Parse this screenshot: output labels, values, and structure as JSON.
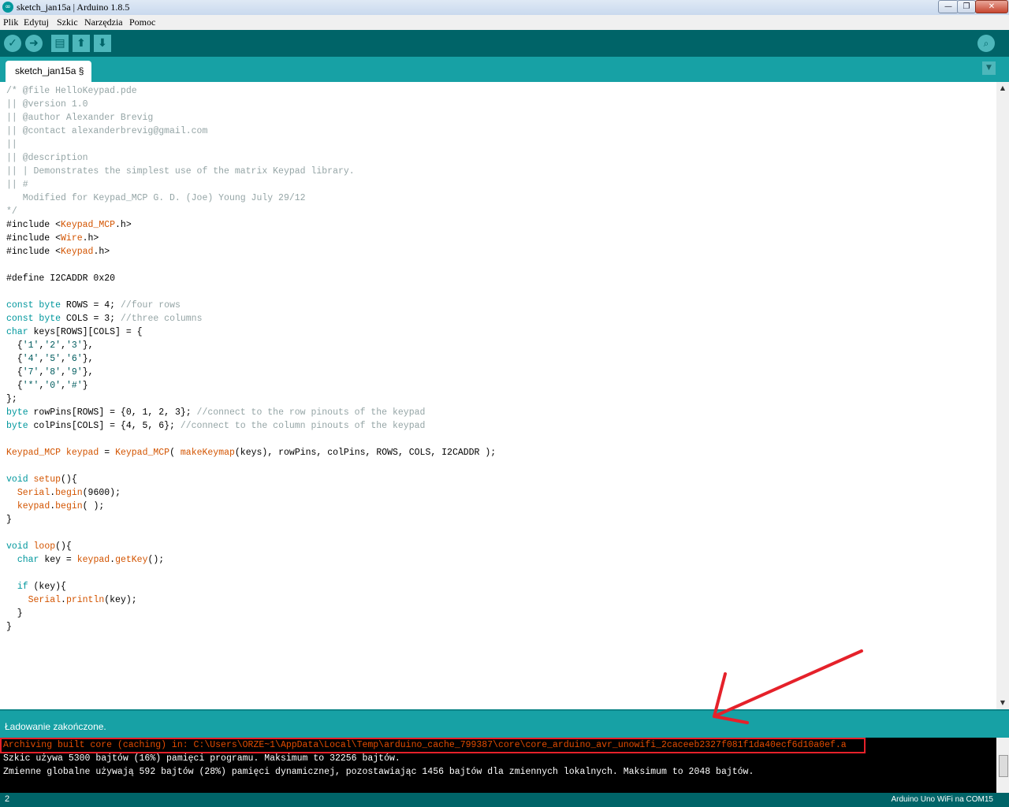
{
  "window": {
    "title": "sketch_jan15a | Arduino 1.8.5",
    "app_icon": "∞",
    "controls": [
      "minimize-icon",
      "maximize-icon",
      "close-icon"
    ],
    "controls_glyphs": [
      "—",
      "❐",
      "✕"
    ]
  },
  "menu": [
    "Plik",
    "Edytuj",
    "Szkic",
    "Narzędzia",
    "Pomoc"
  ],
  "toolbar": {
    "buttons": [
      "verify-icon",
      "upload-icon",
      "new-icon",
      "open-icon",
      "save-icon"
    ],
    "glyphs": [
      "✓",
      "➜",
      "▤",
      "⬆",
      "⬇"
    ],
    "serial_glyph": "⌕"
  },
  "tabs": {
    "active": "sketch_jan15a §",
    "menu_glyph": "▼"
  },
  "editor": {
    "code": [
      [
        [
          "/* @file HelloKeypad.pde",
          "com"
        ]
      ],
      [
        [
          "|| @version 1.0",
          "com"
        ]
      ],
      [
        [
          "|| @author Alexander Brevig",
          "com"
        ]
      ],
      [
        [
          "|| @contact alexanderbrevig@gmail.com",
          "com"
        ]
      ],
      [
        [
          "||",
          "com"
        ]
      ],
      [
        [
          "|| @description",
          "com"
        ]
      ],
      [
        [
          "|| | Demonstrates the simplest use of the matrix Keypad library.",
          "com"
        ]
      ],
      [
        [
          "|| #",
          "com"
        ]
      ],
      [
        [
          "   Modified for Keypad_MCP G. D. (Joe) Young July 29/12",
          "com"
        ]
      ],
      [
        [
          "*/",
          "com"
        ]
      ],
      [
        [
          "#include <",
          ""
        ],
        [
          "Keypad_MCP",
          "lib"
        ],
        [
          ".h>",
          ""
        ]
      ],
      [
        [
          "#include <",
          ""
        ],
        [
          "Wire",
          "lib"
        ],
        [
          ".h>",
          ""
        ]
      ],
      [
        [
          "#include <",
          ""
        ],
        [
          "Keypad",
          "lib"
        ],
        [
          ".h>",
          ""
        ]
      ],
      [],
      [
        [
          "#define I2CADDR 0x20",
          ""
        ]
      ],
      [],
      [
        [
          "const",
          "kw"
        ],
        [
          " ",
          ""
        ],
        [
          "byte",
          "kw"
        ],
        [
          " ROWS = 4; ",
          ""
        ],
        [
          "//four rows",
          "com"
        ]
      ],
      [
        [
          "const",
          "kw"
        ],
        [
          " ",
          ""
        ],
        [
          "byte",
          "kw"
        ],
        [
          " COLS = 3; ",
          ""
        ],
        [
          "//three columns",
          "com"
        ]
      ],
      [
        [
          "char",
          "kw"
        ],
        [
          " keys[ROWS][COLS] = {",
          ""
        ]
      ],
      [
        [
          "  {",
          ""
        ],
        [
          "'1'",
          "str"
        ],
        [
          ",",
          ""
        ],
        [
          "'2'",
          "str"
        ],
        [
          ",",
          ""
        ],
        [
          "'3'",
          "str"
        ],
        [
          "},",
          ""
        ]
      ],
      [
        [
          "  {",
          ""
        ],
        [
          "'4'",
          "str"
        ],
        [
          ",",
          ""
        ],
        [
          "'5'",
          "str"
        ],
        [
          ",",
          ""
        ],
        [
          "'6'",
          "str"
        ],
        [
          "},",
          ""
        ]
      ],
      [
        [
          "  {",
          ""
        ],
        [
          "'7'",
          "str"
        ],
        [
          ",",
          ""
        ],
        [
          "'8'",
          "str"
        ],
        [
          ",",
          ""
        ],
        [
          "'9'",
          "str"
        ],
        [
          "},",
          ""
        ]
      ],
      [
        [
          "  {",
          ""
        ],
        [
          "'*'",
          "str"
        ],
        [
          ",",
          ""
        ],
        [
          "'0'",
          "str"
        ],
        [
          ",",
          ""
        ],
        [
          "'#'",
          "str"
        ],
        [
          "}",
          ""
        ]
      ],
      [
        [
          "};",
          ""
        ]
      ],
      [
        [
          "byte",
          "kw"
        ],
        [
          " rowPins[ROWS] = {0, 1, 2, 3}; ",
          ""
        ],
        [
          "//connect to the row pinouts of the keypad",
          "com"
        ]
      ],
      [
        [
          "byte",
          "kw"
        ],
        [
          " colPins[COLS] = {4, 5, 6}; ",
          ""
        ],
        [
          "//connect to the column pinouts of the keypad",
          "com"
        ]
      ],
      [],
      [
        [
          "Keypad_MCP",
          "lib"
        ],
        [
          " ",
          ""
        ],
        [
          "keypad",
          "lib"
        ],
        [
          " = ",
          ""
        ],
        [
          "Keypad_MCP",
          "lib"
        ],
        [
          "( ",
          ""
        ],
        [
          "makeKeymap",
          "lib"
        ],
        [
          "(keys), rowPins, colPins, ROWS, COLS, I2CADDR );",
          ""
        ]
      ],
      [],
      [
        [
          "void",
          "kw"
        ],
        [
          " ",
          ""
        ],
        [
          "setup",
          "lib"
        ],
        [
          "(){",
          ""
        ]
      ],
      [
        [
          "  ",
          ""
        ],
        [
          "Serial",
          "lib"
        ],
        [
          ".",
          ""
        ],
        [
          "begin",
          "lib"
        ],
        [
          "(9600);",
          ""
        ]
      ],
      [
        [
          "  ",
          ""
        ],
        [
          "keypad",
          "lib"
        ],
        [
          ".",
          ""
        ],
        [
          "begin",
          "lib"
        ],
        [
          "( );",
          ""
        ]
      ],
      [
        [
          "}",
          ""
        ]
      ],
      [],
      [
        [
          "void",
          "kw"
        ],
        [
          " ",
          ""
        ],
        [
          "loop",
          "lib"
        ],
        [
          "(){",
          ""
        ]
      ],
      [
        [
          "  ",
          ""
        ],
        [
          "char",
          "kw"
        ],
        [
          " key = ",
          ""
        ],
        [
          "keypad",
          "lib"
        ],
        [
          ".",
          ""
        ],
        [
          "getKey",
          "lib"
        ],
        [
          "();",
          ""
        ]
      ],
      [],
      [
        [
          "  ",
          ""
        ],
        [
          "if",
          "kw"
        ],
        [
          " (key){",
          ""
        ]
      ],
      [
        [
          "    ",
          ""
        ],
        [
          "Serial",
          "lib"
        ],
        [
          ".",
          ""
        ],
        [
          "println",
          "lib"
        ],
        [
          "(key);",
          ""
        ]
      ],
      [
        [
          "  }",
          ""
        ]
      ],
      [
        [
          "}",
          ""
        ]
      ]
    ]
  },
  "status": {
    "message": "Ładowanie zakończone."
  },
  "console": {
    "lines": [
      "Archiving built core (caching) in: C:\\Users\\ORZE~1\\AppData\\Local\\Temp\\arduino_cache_799387\\core\\core_arduino_avr_unowifi_2caceeb2327f081f1da40ecf6d10a0ef.a",
      "Szkic używa 5300 bajtów (16%) pamięci programu. Maksimum to 32256 bajtów.",
      "Zmienne globalne używają 592 bajtów (28%) pamięci dynamicznej, pozostawiając 1456 bajtów dla zmiennych lokalnych. Maksimum to 2048 bajtów."
    ]
  },
  "bottom": {
    "line_number": "2",
    "board": "Arduino Uno WiFi na COM15"
  },
  "annotation": {
    "color": "#e5212a"
  },
  "scroll_glyphs": {
    "up": "▲",
    "down": "▼"
  }
}
